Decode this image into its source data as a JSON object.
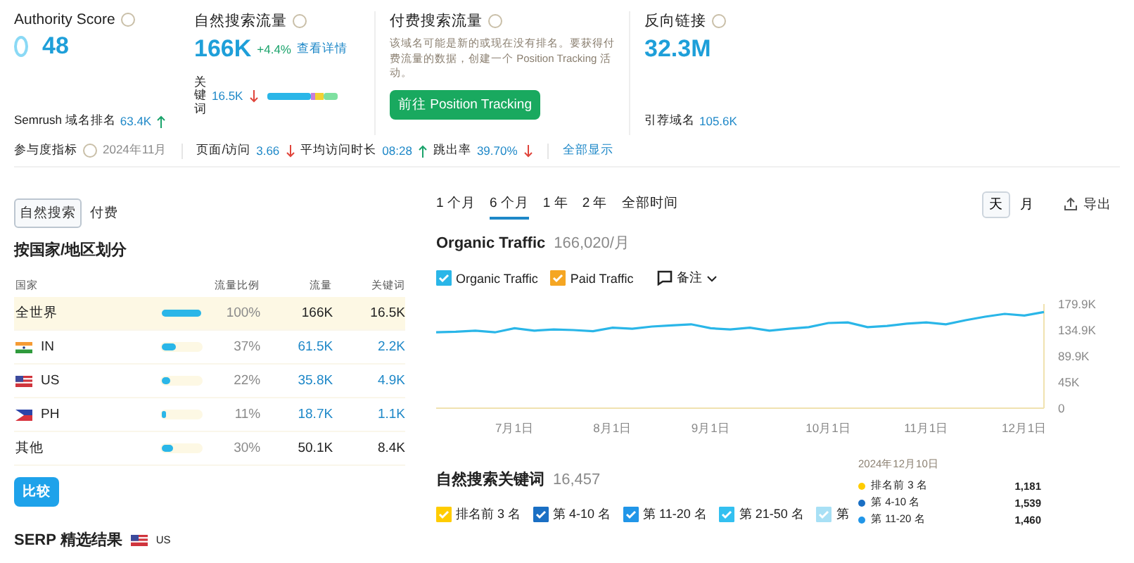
{
  "overview": {
    "authority": {
      "label": "Authority Score",
      "value": "48",
      "rank_label": "Semrush 域名排名",
      "rank_value": "63.4K",
      "rank_rising": true
    },
    "organic": {
      "label": "自然搜索流量",
      "value": "166K",
      "change": "+4.4%",
      "link": "查看详情",
      "kw_label": "关键词",
      "kw_value": "16.5K",
      "kw_rising": false
    },
    "paid": {
      "label": "付费搜索流量",
      "text": "该域名可能是新的或现在没有排名。要获得付费流量的数据，创建一个 Position Tracking 活动。",
      "button": "前往 Position Tracking"
    },
    "backlinks": {
      "label": "反向链接",
      "value": "32.3M",
      "ref_label": "引荐域名",
      "ref_value": "105.6K"
    }
  },
  "engagement": {
    "label": "参与度指标",
    "date": "2024年11月",
    "metrics": [
      {
        "label": "页面/访问",
        "value": "3.66",
        "rising": false
      },
      {
        "label": "平均访问时长",
        "value": "08:28",
        "rising": true
      },
      {
        "label": "跳出率",
        "value": "39.70%",
        "rising": false
      }
    ],
    "link": "全部显示"
  },
  "source_tabs": [
    {
      "label": "自然搜索",
      "selected": true
    },
    {
      "label": "付费",
      "selected": false
    }
  ],
  "countries": {
    "title": "按国家/地区划分",
    "columns": [
      "国家",
      "流量比例",
      "流量",
      "关键词"
    ],
    "rows": [
      {
        "name": "全世界",
        "kind": "plain",
        "level": 1.0,
        "share": "100%",
        "traffic": "166K",
        "keywords": "16.5K",
        "link": false,
        "selected": true
      },
      {
        "name": "IN",
        "kind": "india",
        "level": 0.37,
        "share": "37%",
        "traffic": "61.5K",
        "keywords": "2.2K",
        "link": true,
        "selected": false
      },
      {
        "name": "US",
        "kind": "usa",
        "level": 0.22,
        "share": "22%",
        "traffic": "35.8K",
        "keywords": "4.9K",
        "link": true,
        "selected": false
      },
      {
        "name": "PH",
        "kind": "philippines",
        "level": 0.11,
        "share": "11%",
        "traffic": "18.7K",
        "keywords": "1.1K",
        "link": true,
        "selected": false
      },
      {
        "name": "其他",
        "kind": "plain",
        "level": 0.3,
        "share": "30%",
        "traffic": "50.1K",
        "keywords": "8.4K",
        "link": false,
        "selected": false
      }
    ],
    "compare": "比较"
  },
  "serp": {
    "title": "SERP 精选结果",
    "country": "US"
  },
  "periods": [
    {
      "label": "1 个月",
      "selected": false
    },
    {
      "label": "6 个月",
      "selected": true
    },
    {
      "label": "1 年",
      "selected": false
    },
    {
      "label": "2 年",
      "selected": false
    },
    {
      "label": "全部时间",
      "selected": false
    }
  ],
  "granularity": [
    {
      "label": "天",
      "selected": true
    },
    {
      "label": "月",
      "selected": false
    }
  ],
  "export": "导出",
  "traffic": {
    "title": "Organic Traffic",
    "value": "166,020/月",
    "legend": [
      {
        "label": "Organic Traffic",
        "color": "#2ab6e8",
        "checked": true
      },
      {
        "label": "Paid Traffic",
        "color": "#f5a623",
        "checked": true
      }
    ],
    "notes": "备注",
    "chart_data": {
      "type": "line",
      "categories": [
        null,
        null,
        null,
        null,
        "7月1日",
        null,
        null,
        null,
        null,
        "8月1日",
        null,
        null,
        null,
        null,
        "9月1日",
        null,
        null,
        null,
        null,
        null,
        "10月1日",
        null,
        null,
        null,
        null,
        "11月1日",
        null,
        null,
        null,
        null,
        "12月1日",
        null
      ],
      "series": [
        {
          "color": "#2ab6e8",
          "values": [
            131000,
            132000,
            134000,
            131000,
            138000,
            134000,
            136000,
            135000,
            133000,
            139000,
            137000,
            141000,
            143000,
            145000,
            138000,
            136000,
            139000,
            134000,
            137000,
            140000,
            147000,
            148000,
            140000,
            142000,
            146000,
            148000,
            145000,
            152000,
            158000,
            163000,
            160000,
            166000
          ]
        }
      ],
      "ylim": [
        0,
        179900
      ],
      "yticks": [
        {
          "value": 0,
          "label": "0"
        },
        {
          "value": 45000,
          "label": "45K"
        },
        {
          "value": 89900,
          "label": "89.9K"
        },
        {
          "value": 134900,
          "label": "134.9K"
        },
        {
          "value": 179900,
          "label": "179.9K"
        }
      ]
    }
  },
  "keywords": {
    "title": "自然搜索关键词",
    "value": "16,457",
    "legend": [
      {
        "label": "排名前 3 名",
        "color": "#ffcc00",
        "checked": true
      },
      {
        "label": "第 4-10 名",
        "color": "#1a6fc4",
        "checked": true
      },
      {
        "label": "第 11-20 名",
        "color": "#2196e8",
        "checked": true
      },
      {
        "label": "第 21-50 名",
        "color": "#33c0f0",
        "checked": true
      },
      {
        "label": "第",
        "color": "#a8e0f5",
        "checked": true
      }
    ],
    "tooltip": {
      "date": "2024年12月10日",
      "rows": [
        {
          "label": "排名前 3 名",
          "value": "1,181",
          "color": "#ffcc00"
        },
        {
          "label": "第 4-10 名",
          "value": "1,539",
          "color": "#1a6fc4"
        },
        {
          "label": "第 11-20 名",
          "value": "1,460",
          "color": "#2196e8"
        }
      ]
    }
  }
}
